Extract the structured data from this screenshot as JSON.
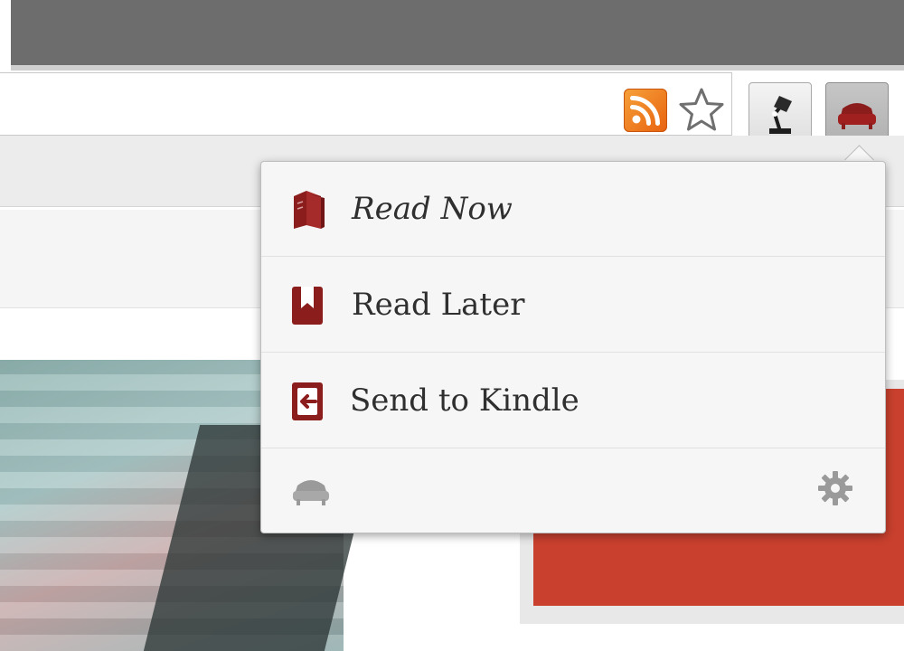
{
  "browser": {
    "address_bar": {
      "value": ""
    },
    "icons": [
      "rss-icon",
      "bookmark-star-icon",
      "lamp-extension-icon",
      "readability-extension-icon"
    ]
  },
  "popup": {
    "items": [
      {
        "label": "Read Now",
        "icon": "books-icon"
      },
      {
        "label": "Read Later",
        "icon": "bookmark-icon"
      },
      {
        "label": "Send to Kindle",
        "icon": "send-icon"
      }
    ],
    "footer": {
      "logo_icon": "readability-logo-icon",
      "settings_icon": "gear-icon"
    }
  },
  "colors": {
    "accent": "#8b1d1d",
    "icon_gray": "#9a9a9a",
    "rss_orange": "#ef7d1f",
    "popup_bg": "#f6f6f6"
  }
}
